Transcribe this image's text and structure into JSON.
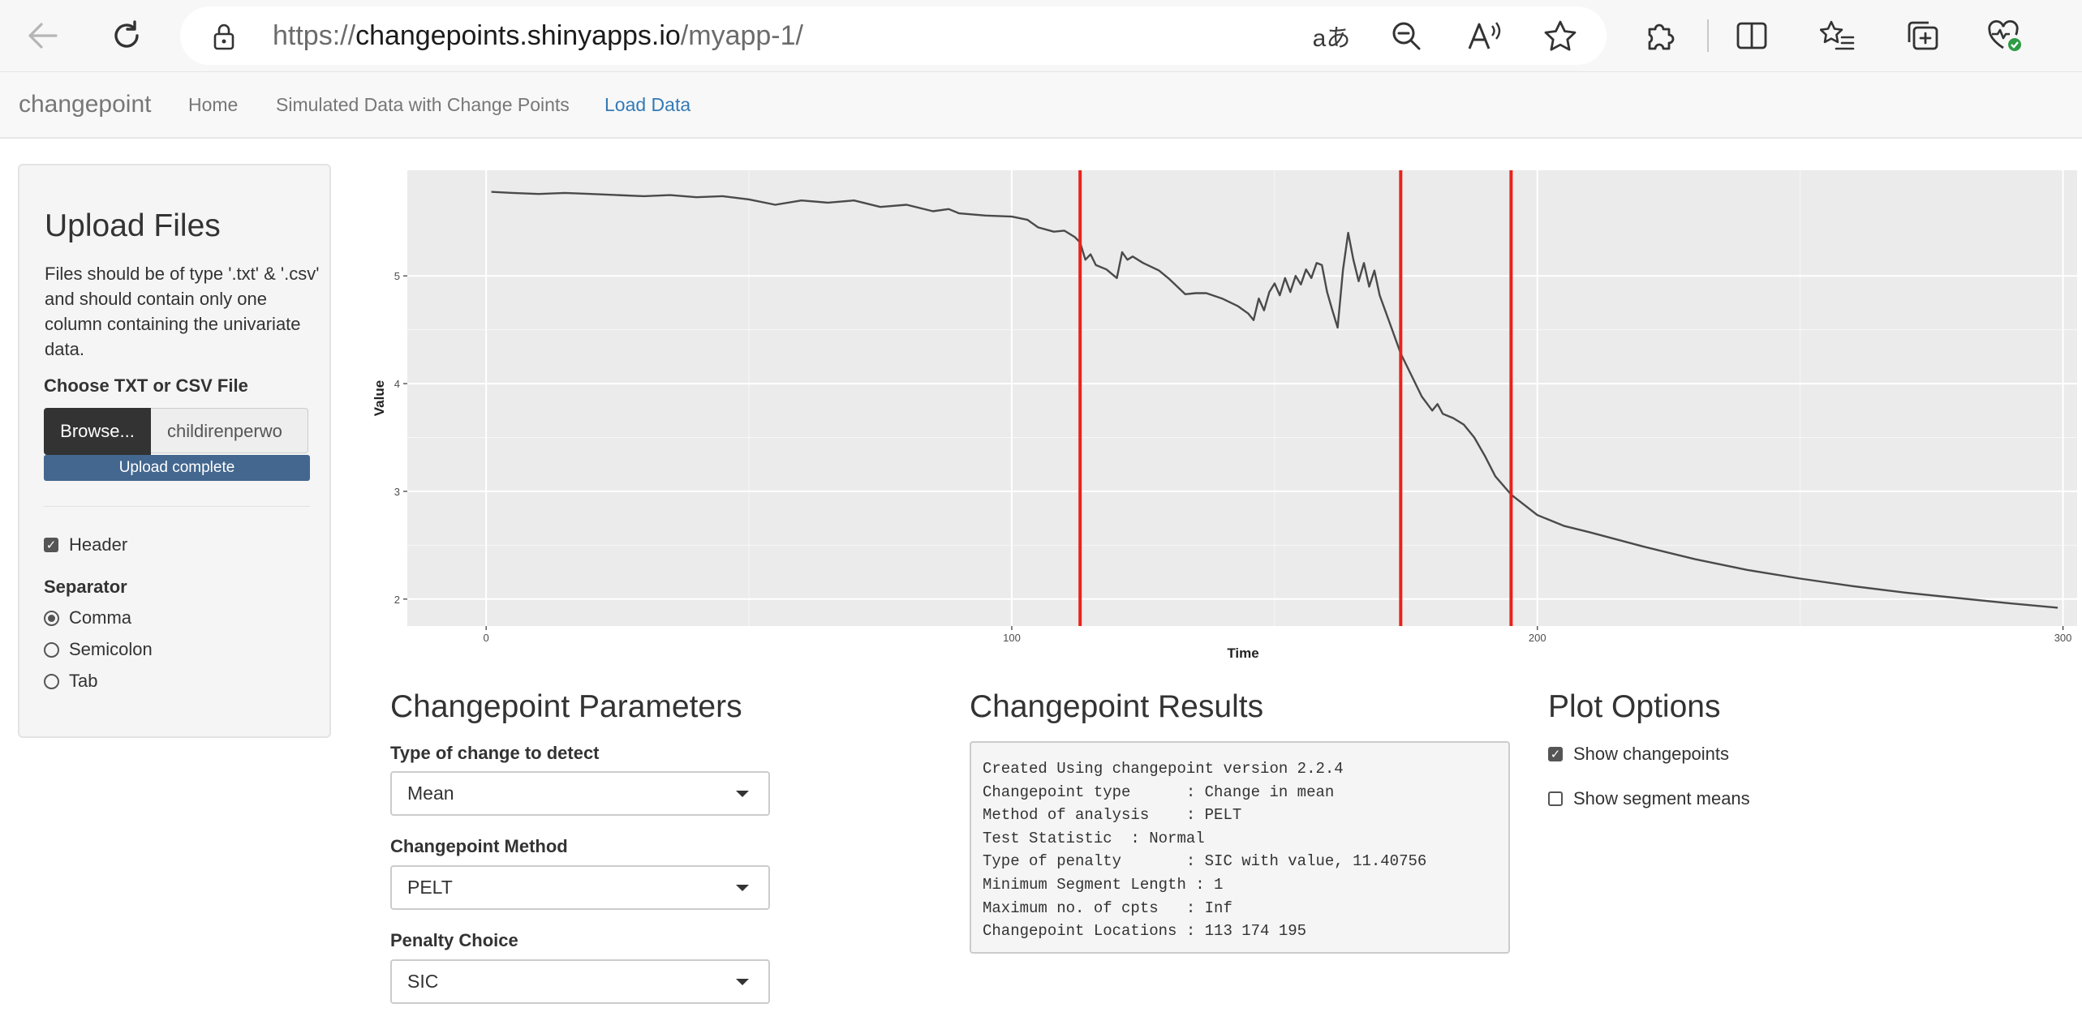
{
  "browser": {
    "url_prefix": "https://",
    "url_host": "changepoints.shinyapps.io",
    "url_path": "/myapp-1/",
    "icons": [
      "back-arrow-icon",
      "refresh-icon",
      "lock-icon",
      "translate-icon",
      "zoom-out-icon",
      "read-aloud-icon",
      "favorite-star-icon",
      "extensions-icon",
      "split-screen-icon",
      "favorites-list-icon",
      "collections-icon",
      "browser-essentials-icon",
      "more-icon"
    ],
    "translate_glyph": "aあ"
  },
  "navbar": {
    "brand": "changepoint",
    "links": [
      "Home",
      "Simulated Data with Change Points",
      "Load Data"
    ],
    "active_index": 2
  },
  "sidebar": {
    "title": "Upload Files",
    "help": "Files should be of type '.txt' & '.csv' and should contain only one column containing the univariate data.",
    "file_label": "Choose TXT or CSV File",
    "browse_label": "Browse...",
    "file_name": "childirenperwo",
    "progress_label": "Upload complete",
    "progress": 1.0,
    "header_label": "Header",
    "header_checked": true,
    "separator_label": "Separator",
    "separator_options": [
      "Comma",
      "Semicolon",
      "Tab"
    ],
    "separator_selected": "Comma"
  },
  "chart_data": {
    "type": "line",
    "xlabel": "Time",
    "ylabel": "Value",
    "xlim": [
      -15,
      303
    ],
    "ylim": [
      1.75,
      5.98
    ],
    "xticks": [
      0,
      100,
      200,
      300
    ],
    "yticks": [
      2,
      3,
      4,
      5
    ],
    "grid": true,
    "colors": {
      "panel": "#ebebeb",
      "grid": "#ffffff",
      "line": "#4a4a4a",
      "changepoint": "#e8231b"
    },
    "changepoints": [
      113,
      174,
      195
    ],
    "series": [
      {
        "x": [
          1,
          5,
          10,
          15,
          20,
          25,
          30,
          35,
          40,
          45,
          50,
          55,
          60,
          65,
          70,
          75,
          80,
          85,
          88,
          90,
          95,
          100,
          103,
          105,
          108,
          110,
          112,
          113,
          114,
          115,
          116,
          118,
          120,
          121,
          122,
          123,
          125,
          128,
          130,
          133,
          135,
          137,
          140,
          143,
          145,
          146,
          147,
          148,
          149,
          150,
          151,
          152,
          153,
          154,
          155,
          156,
          157,
          158,
          159,
          160,
          161,
          162,
          163,
          164,
          165,
          166,
          167,
          168,
          169,
          170,
          172,
          174,
          176,
          178,
          180,
          181,
          182,
          184,
          186,
          188,
          190,
          192,
          195,
          200,
          205,
          210,
          220,
          230,
          240,
          250,
          260,
          270,
          280,
          290,
          299
        ],
        "y": [
          5.78,
          5.77,
          5.76,
          5.77,
          5.76,
          5.75,
          5.74,
          5.75,
          5.73,
          5.74,
          5.71,
          5.66,
          5.7,
          5.68,
          5.7,
          5.64,
          5.66,
          5.6,
          5.62,
          5.58,
          5.56,
          5.55,
          5.52,
          5.45,
          5.41,
          5.42,
          5.36,
          5.31,
          5.15,
          5.2,
          5.1,
          5.06,
          4.98,
          5.22,
          5.15,
          5.18,
          5.12,
          5.05,
          4.97,
          4.83,
          4.84,
          4.84,
          4.79,
          4.72,
          4.65,
          4.59,
          4.79,
          4.68,
          4.85,
          4.93,
          4.82,
          4.98,
          4.85,
          5.0,
          4.92,
          5.06,
          4.98,
          5.12,
          5.1,
          4.85,
          4.68,
          4.52,
          5.05,
          5.4,
          5.15,
          4.95,
          5.12,
          4.9,
          5.05,
          4.82,
          4.55,
          4.28,
          4.08,
          3.88,
          3.75,
          3.81,
          3.72,
          3.68,
          3.62,
          3.5,
          3.33,
          3.14,
          2.97,
          2.78,
          2.68,
          2.62,
          2.49,
          2.37,
          2.27,
          2.19,
          2.12,
          2.06,
          2.01,
          1.96,
          1.92
        ]
      }
    ]
  },
  "params": {
    "title": "Changepoint Parameters",
    "type_label": "Type of change to detect",
    "type_value": "Mean",
    "method_label": "Changepoint Method",
    "method_value": "PELT",
    "penalty_label": "Penalty Choice",
    "penalty_value": "SIC"
  },
  "results": {
    "title": "Changepoint Results",
    "lines": [
      "Created Using changepoint version 2.2.4",
      "Changepoint type      : Change in mean",
      "Method of analysis    : PELT",
      "Test Statistic  : Normal",
      "Type of penalty       : SIC with value, 11.40756",
      "Minimum Segment Length : 1",
      "Maximum no. of cpts   : Inf",
      "Changepoint Locations : 113 174 195"
    ]
  },
  "plot_options": {
    "title": "Plot Options",
    "show_changepoints_label": "Show changepoints",
    "show_changepoints": true,
    "show_segment_means_label": "Show segment means",
    "show_segment_means": false
  }
}
